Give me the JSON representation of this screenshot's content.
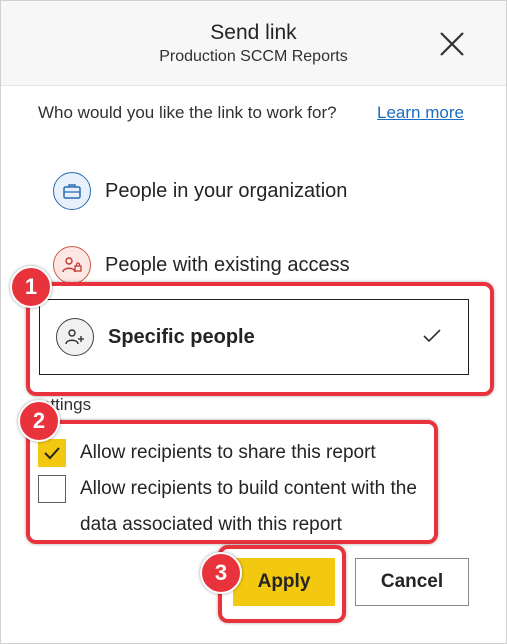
{
  "dialog": {
    "title": "Send link",
    "subtitle": "Production SCCM Reports",
    "close_icon": "close-icon"
  },
  "prompt": {
    "question": "Who would you like the link to work for?",
    "learn_more": "Learn more"
  },
  "options": [
    {
      "label": "People in your organization",
      "icon": "briefcase-icon"
    },
    {
      "label": "People with existing access",
      "icon": "people-lock-icon"
    },
    {
      "label": "Specific people",
      "icon": "people-add-icon",
      "selected": true
    }
  ],
  "settings": {
    "heading": "ettings",
    "checkboxes": [
      {
        "label": "Allow recipients to share this report",
        "checked": true
      },
      {
        "label": "Allow recipients to build content with the data associated with this report",
        "checked": false
      }
    ]
  },
  "buttons": {
    "apply": "Apply",
    "cancel": "Cancel"
  },
  "callouts": [
    "1",
    "2",
    "3"
  ],
  "colors": {
    "accent": "#f2c811",
    "callout": "#e8333c",
    "link": "#1b6ec2"
  }
}
